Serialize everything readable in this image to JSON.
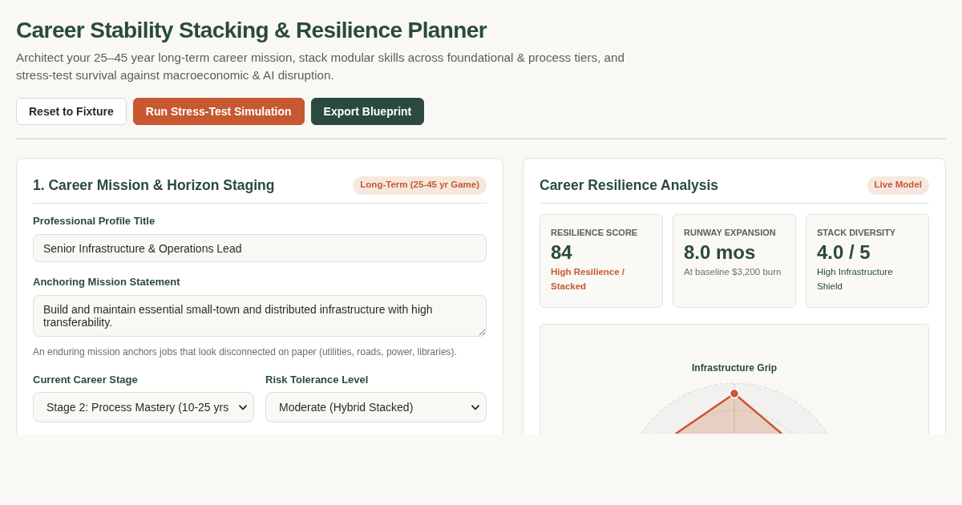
{
  "header": {
    "title": "Career Stability Stacking & Resilience Planner",
    "subtitle": "Architect your 25–45 year long-term career mission, stack modular skills across foundational & process tiers, and stress-test survival against macroeconomic & AI disruption.",
    "buttons": [
      {
        "label": "Reset to Fixture",
        "kind": "secondary"
      },
      {
        "label": "Run Stress-Test Simulation",
        "kind": "accent"
      },
      {
        "label": "Export Blueprint",
        "kind": "primary"
      }
    ]
  },
  "mission_panel": {
    "title": "1. Career Mission & Horizon Staging",
    "badge": "Long-Term (25-45 yr Game)",
    "fields": [
      {
        "kind": "text",
        "label": "Professional Profile Title",
        "value": "Senior Infrastructure & Operations Lead"
      },
      {
        "kind": "textarea",
        "label": "Anchoring Mission Statement",
        "value": "Build and maintain essential small-town and distributed infrastructure with high transferability.",
        "hint": "An enduring mission anchors jobs that look disconnected on paper (utilities, roads, power, libraries)."
      }
    ],
    "selects": [
      {
        "label": "Current Career Stage",
        "value": "Stage 2: Process Mastery (10-25 yrs"
      },
      {
        "label": "Risk Tolerance Level",
        "value": "Moderate (Hybrid Stacked)"
      }
    ]
  },
  "analysis_panel": {
    "title": "Career Resilience Analysis",
    "badge": "Live Model",
    "metrics": [
      {
        "label": "RESILIENCE SCORE",
        "value": "84",
        "note": "High Resilience / Stacked",
        "kind": "alert"
      },
      {
        "label": "RUNWAY EXPANSION",
        "value": "8.0 mos",
        "note": "At baseline $3,200 burn",
        "kind": "neutral"
      },
      {
        "label": "STACK DIVERSITY",
        "value": "4.0 / 5",
        "note": "High Infrastructure Shield",
        "kind": "positive"
      }
    ],
    "radar": {
      "axis_labels": [
        "Infrastructure Grip"
      ]
    }
  }
}
